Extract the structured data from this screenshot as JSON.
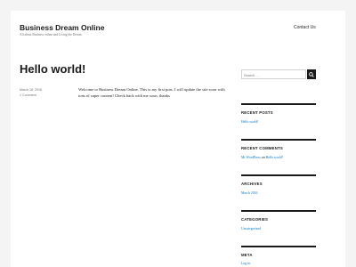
{
  "site": {
    "title": "Business Dream Online",
    "tagline": "All about Business online and Living the Dream"
  },
  "nav": {
    "contact": "Contact Us"
  },
  "post": {
    "title": "Hello world!",
    "date": "March 18, 2016",
    "comments": "1 Comment",
    "content": "Welcome to Business Dream Online. This is my first post. I will update the site soon with tons of super content! Check back with me soon, thanks"
  },
  "search": {
    "placeholder": "Search …"
  },
  "widgets": {
    "recent_posts": {
      "title": "RECENT POSTS",
      "items": [
        "Hello world!"
      ]
    },
    "recent_comments": {
      "title": "RECENT COMMENTS",
      "author": "Mr WordPress",
      "on": "on",
      "post": "Hello world!"
    },
    "archives": {
      "title": "ARCHIVES",
      "items": [
        "March 2016"
      ]
    },
    "categories": {
      "title": "CATEGORIES",
      "items": [
        "Uncategorized"
      ]
    },
    "meta": {
      "title": "META",
      "items": [
        "Log in"
      ]
    }
  },
  "icons": {
    "search": "search-icon"
  },
  "colors": {
    "link": "#007acc",
    "text": "#1a1a1a",
    "muted": "#707070"
  }
}
